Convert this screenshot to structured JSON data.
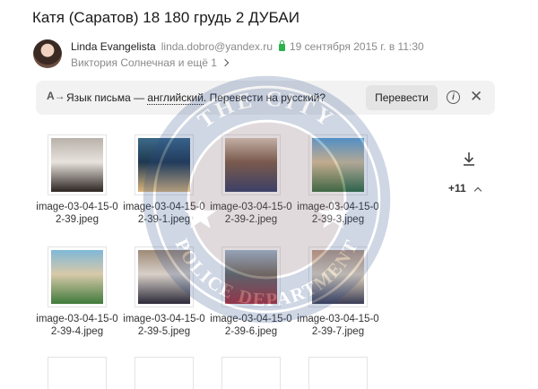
{
  "email": {
    "subject": "Катя (Саратов) 18 180 грудь 2 ДУБАИ",
    "sender_name": "Linda Evangelista",
    "sender_email": "linda.dobro@yandex.ru",
    "sent_date": "19 сентября 2015 г. в 11:30",
    "recipients": "Виктория Солнечная и ещё 1"
  },
  "translate_bar": {
    "icon_glyph": "A→",
    "prefix": "Язык письма — ",
    "language": "английский",
    "suffix": ". Перевести на русский?",
    "button_label": "Перевести",
    "info_glyph": "i",
    "close_glyph": "✕"
  },
  "attachments": [
    {
      "name": "image-03-04-15-02-39.jpeg",
      "colors": [
        "#b9b2ab",
        "#2d2522",
        "#e7e2dc"
      ]
    },
    {
      "name": "image-03-04-15-02-39-1.jpeg",
      "colors": [
        "#3c6a8a",
        "#d9b57a",
        "#1f3850"
      ]
    },
    {
      "name": "image-03-04-15-02-39-2.jpeg",
      "colors": [
        "#d8c7b5",
        "#2b3a66",
        "#7a5a45"
      ]
    },
    {
      "name": "image-03-04-15-02-39-3.jpeg",
      "colors": [
        "#5fa3d6",
        "#2f6b3a",
        "#d8c39a"
      ]
    },
    {
      "name": "image-03-04-15-02-39-4.jpeg",
      "colors": [
        "#7fb8d8",
        "#3f7a3a",
        "#d8c9a9"
      ]
    },
    {
      "name": "image-03-04-15-02-39-5.jpeg",
      "colors": [
        "#9e8a78",
        "#2d2a3a",
        "#d7d0c8"
      ]
    },
    {
      "name": "image-03-04-15-02-39-6.jpeg",
      "colors": [
        "#9db8cf",
        "#b0303a",
        "#6c6a62"
      ]
    },
    {
      "name": "image-03-04-15-02-39-7.jpeg",
      "colors": [
        "#b99b86",
        "#3a3d55",
        "#e6d7bf"
      ]
    }
  ],
  "more_attachments": "+11",
  "watermark": {
    "top_text": "THE CITY",
    "bottom_text": "POLICE DEPARTMENT"
  }
}
